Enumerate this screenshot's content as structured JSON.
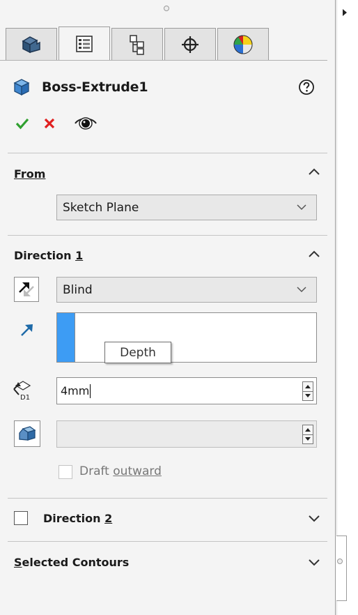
{
  "feature": {
    "title": "Boss-Extrude1",
    "help_icon": "help-circle-icon",
    "ok_icon": "checkmark-icon",
    "cancel_icon": "x-icon",
    "preview_icon": "eye-icon"
  },
  "tabs": [
    {
      "name": "featuremanager-design-tree",
      "icon": "feature-tree-icon"
    },
    {
      "name": "propertymanager",
      "icon": "property-list-icon",
      "active": true
    },
    {
      "name": "configurationmanager",
      "icon": "configuration-icon"
    },
    {
      "name": "dimxpertmanager",
      "icon": "crosshair-icon"
    },
    {
      "name": "displaymanager",
      "icon": "appearance-ball-icon"
    }
  ],
  "from_section": {
    "title": "From",
    "value": "Sketch Plane"
  },
  "direction1": {
    "title_prefix": "Direction ",
    "title_num": "1",
    "end_condition": "Blind",
    "depth_tooltip": "Depth",
    "depth_value": "4mm",
    "draft_value": "",
    "draft_outward_prefix": "Draft ",
    "draft_outward_suffix": "outward"
  },
  "direction2": {
    "title_prefix": "Direction ",
    "title_num": "2"
  },
  "selected_contours": {
    "title_first": "S",
    "title_rest": "elected Contours"
  },
  "colors": {
    "accent_blue": "#3d9cf4",
    "ok_green": "#2fa02f",
    "cancel_red": "#e01f1f"
  }
}
